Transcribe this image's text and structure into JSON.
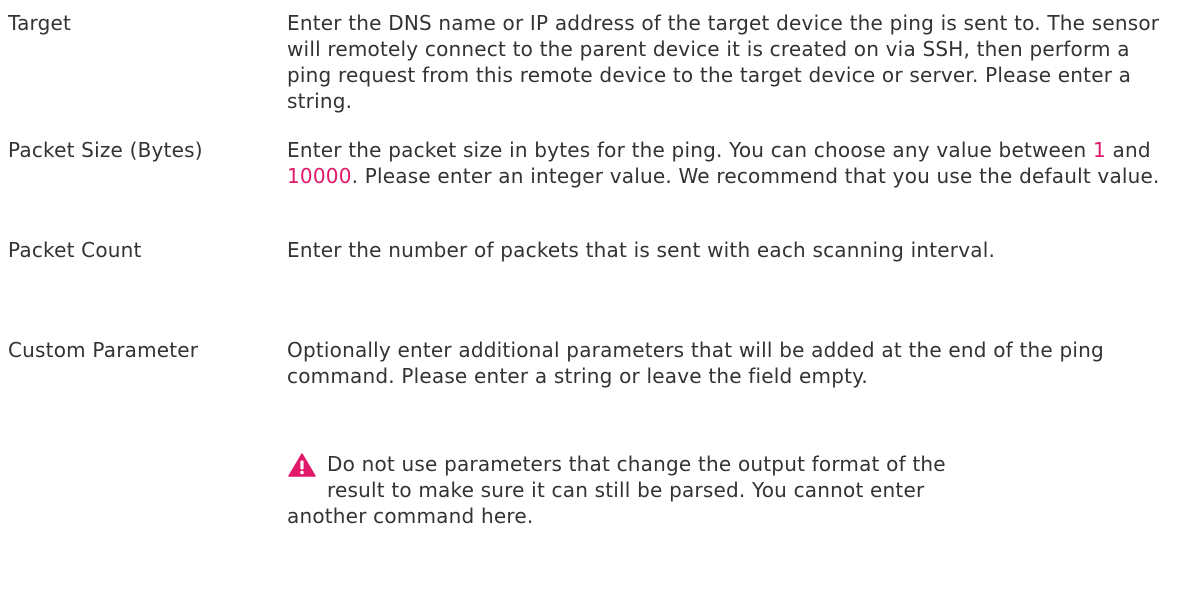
{
  "rows": [
    {
      "label": "Target",
      "description": "Enter the DNS name or IP address of the target device the ping is sent to. The sensor will remotely connect to the parent device it is created on via SSH, then perform a ping request from this remote device to the target device or server. Please enter a string."
    },
    {
      "label": "Packet Size (Bytes)",
      "description_before": "Enter the packet size in bytes for the ping. You can choose any value between ",
      "min_value": "1",
      "description_between": " and ",
      "max_value": "10000",
      "description_after": ". Please enter an integer value. We recommend that you use the default value."
    },
    {
      "label": "Packet Count",
      "description": "Enter the number of packets that is sent with each scanning interval."
    },
    {
      "label": "Custom Parameter",
      "description": "Optionally enter additional parameters that will be added at the end of the ping command. Please enter a string or leave the field empty."
    }
  ],
  "note": {
    "icon": "warning-icon",
    "line1": "Do not use parameters that change the output format of the",
    "line2": "result to make sure it can still be parsed. You cannot enter",
    "line3": "another command here."
  },
  "colors": {
    "text": "#333333",
    "highlight": "#e0196b",
    "warning": "#e0196b"
  }
}
